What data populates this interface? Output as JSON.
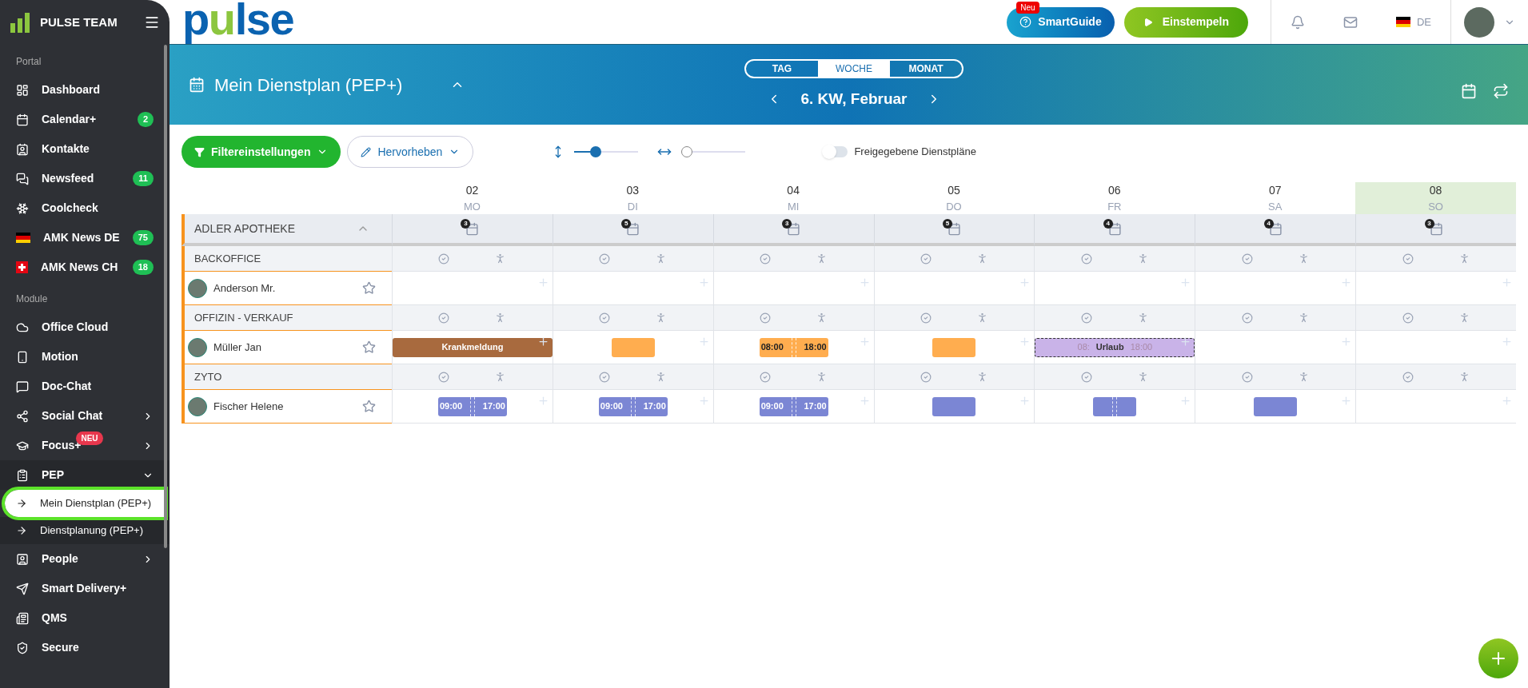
{
  "sidebar": {
    "brand": "PULSE TEAM",
    "sections": [
      {
        "label": "Portal",
        "items": [
          {
            "label": "Dashboard"
          },
          {
            "label": "Calendar+",
            "badge": "2"
          },
          {
            "label": "Kontakte"
          },
          {
            "label": "Newsfeed",
            "badge": "11"
          },
          {
            "label": "Coolcheck"
          },
          {
            "label": "AMK News DE",
            "badge": "75"
          },
          {
            "label": "AMK News CH",
            "badge": "18"
          }
        ]
      },
      {
        "label": "Module",
        "items": [
          {
            "label": "Office Cloud"
          },
          {
            "label": "Motion"
          },
          {
            "label": "Doc-Chat"
          },
          {
            "label": "Social Chat",
            "expanded": false
          },
          {
            "label": "Focus+",
            "tag": "NEU",
            "expanded": false
          },
          {
            "label": "PEP",
            "expanded": true,
            "children": [
              {
                "label": "Mein Dienstplan (PEP+)",
                "selected": true
              },
              {
                "label": "Dienstplanung (PEP+)",
                "selected": false
              }
            ]
          },
          {
            "label": "People",
            "expanded": false
          },
          {
            "label": "Smart Delivery+"
          },
          {
            "label": "QMS"
          },
          {
            "label": "Secure"
          }
        ]
      }
    ]
  },
  "topbar": {
    "logo": "pulse",
    "smartguide": {
      "label": "SmartGuide",
      "tag": "Neu"
    },
    "clock_in": "Einstempeln",
    "language": "DE"
  },
  "banner": {
    "title": "Mein Dienstplan (PEP+)",
    "views": [
      {
        "label": "TAG",
        "selected": false
      },
      {
        "label": "WOCHE",
        "selected": true
      },
      {
        "label": "MONAT",
        "selected": false
      }
    ],
    "period": "6. KW, Februar"
  },
  "toolbar": {
    "filter": "Filtereinstellungen",
    "highlight": "Hervorheben",
    "row_height": {
      "level": 0.3
    },
    "column_width": {
      "level": 0.0
    },
    "shared_toggle": {
      "label": "Freigegebene Dienstpläne",
      "on": false
    }
  },
  "schedule": {
    "days": [
      {
        "date": "02",
        "weekday": "MO",
        "count": "3",
        "selected": false
      },
      {
        "date": "03",
        "weekday": "DI",
        "count": "5",
        "selected": false
      },
      {
        "date": "04",
        "weekday": "MI",
        "count": "3",
        "selected": false
      },
      {
        "date": "05",
        "weekday": "DO",
        "count": "5",
        "selected": false
      },
      {
        "date": "06",
        "weekday": "FR",
        "count": "4",
        "selected": false
      },
      {
        "date": "07",
        "weekday": "SA",
        "count": "4",
        "selected": false
      },
      {
        "date": "08",
        "weekday": "SO",
        "count": "3",
        "selected": true
      }
    ],
    "location": {
      "name": "ADLER APOTHEKE",
      "expanded": true
    },
    "groups": [
      {
        "name": "BACKOFFICE",
        "employees": [
          {
            "name": "Anderson Mr.",
            "favorite": false,
            "cells": [
              {},
              {},
              {},
              {},
              {},
              {},
              {}
            ]
          }
        ]
      },
      {
        "name": "OFFIZIN - VERKAUF",
        "employees": [
          {
            "name": "Müller Jan",
            "favorite": false,
            "cells": [
              {
                "shift": {
                  "kind": "absence",
                  "label": "Krankmeldung",
                  "color": "#a86a3e"
                }
              },
              {
                "shift": {
                  "kind": "shift",
                  "color": "#ffad4f"
                }
              },
              {
                "shift": {
                  "kind": "shift",
                  "start": "08:00",
                  "end": "18:00",
                  "color": "#ffad4f"
                }
              },
              {
                "shift": {
                  "kind": "shift",
                  "color": "#ffad4f"
                }
              },
              {
                "shift": {
                  "kind": "leave",
                  "label": "Urlaub",
                  "start": "08:",
                  "end": "18:00",
                  "color": "#c9b3e8"
                }
              },
              {},
              {}
            ]
          }
        ]
      },
      {
        "name": "ZYTO",
        "employees": [
          {
            "name": "Fischer Helene",
            "favorite": false,
            "cells": [
              {
                "shift": {
                  "kind": "shift",
                  "start": "09:00",
                  "end": "17:00",
                  "color": "#7b86d4"
                }
              },
              {
                "shift": {
                  "kind": "shift",
                  "start": "09:00",
                  "end": "17:00",
                  "color": "#7b86d4"
                }
              },
              {
                "shift": {
                  "kind": "shift",
                  "start": "09:00",
                  "end": "17:00",
                  "color": "#7b86d4"
                }
              },
              {
                "shift": {
                  "kind": "shift",
                  "color": "#7b86d4"
                }
              },
              {
                "shift": {
                  "kind": "shift",
                  "split": true,
                  "color": "#7b86d4"
                }
              },
              {
                "shift": {
                  "kind": "shift",
                  "color": "#7b86d4"
                }
              },
              {}
            ]
          }
        ]
      }
    ]
  }
}
